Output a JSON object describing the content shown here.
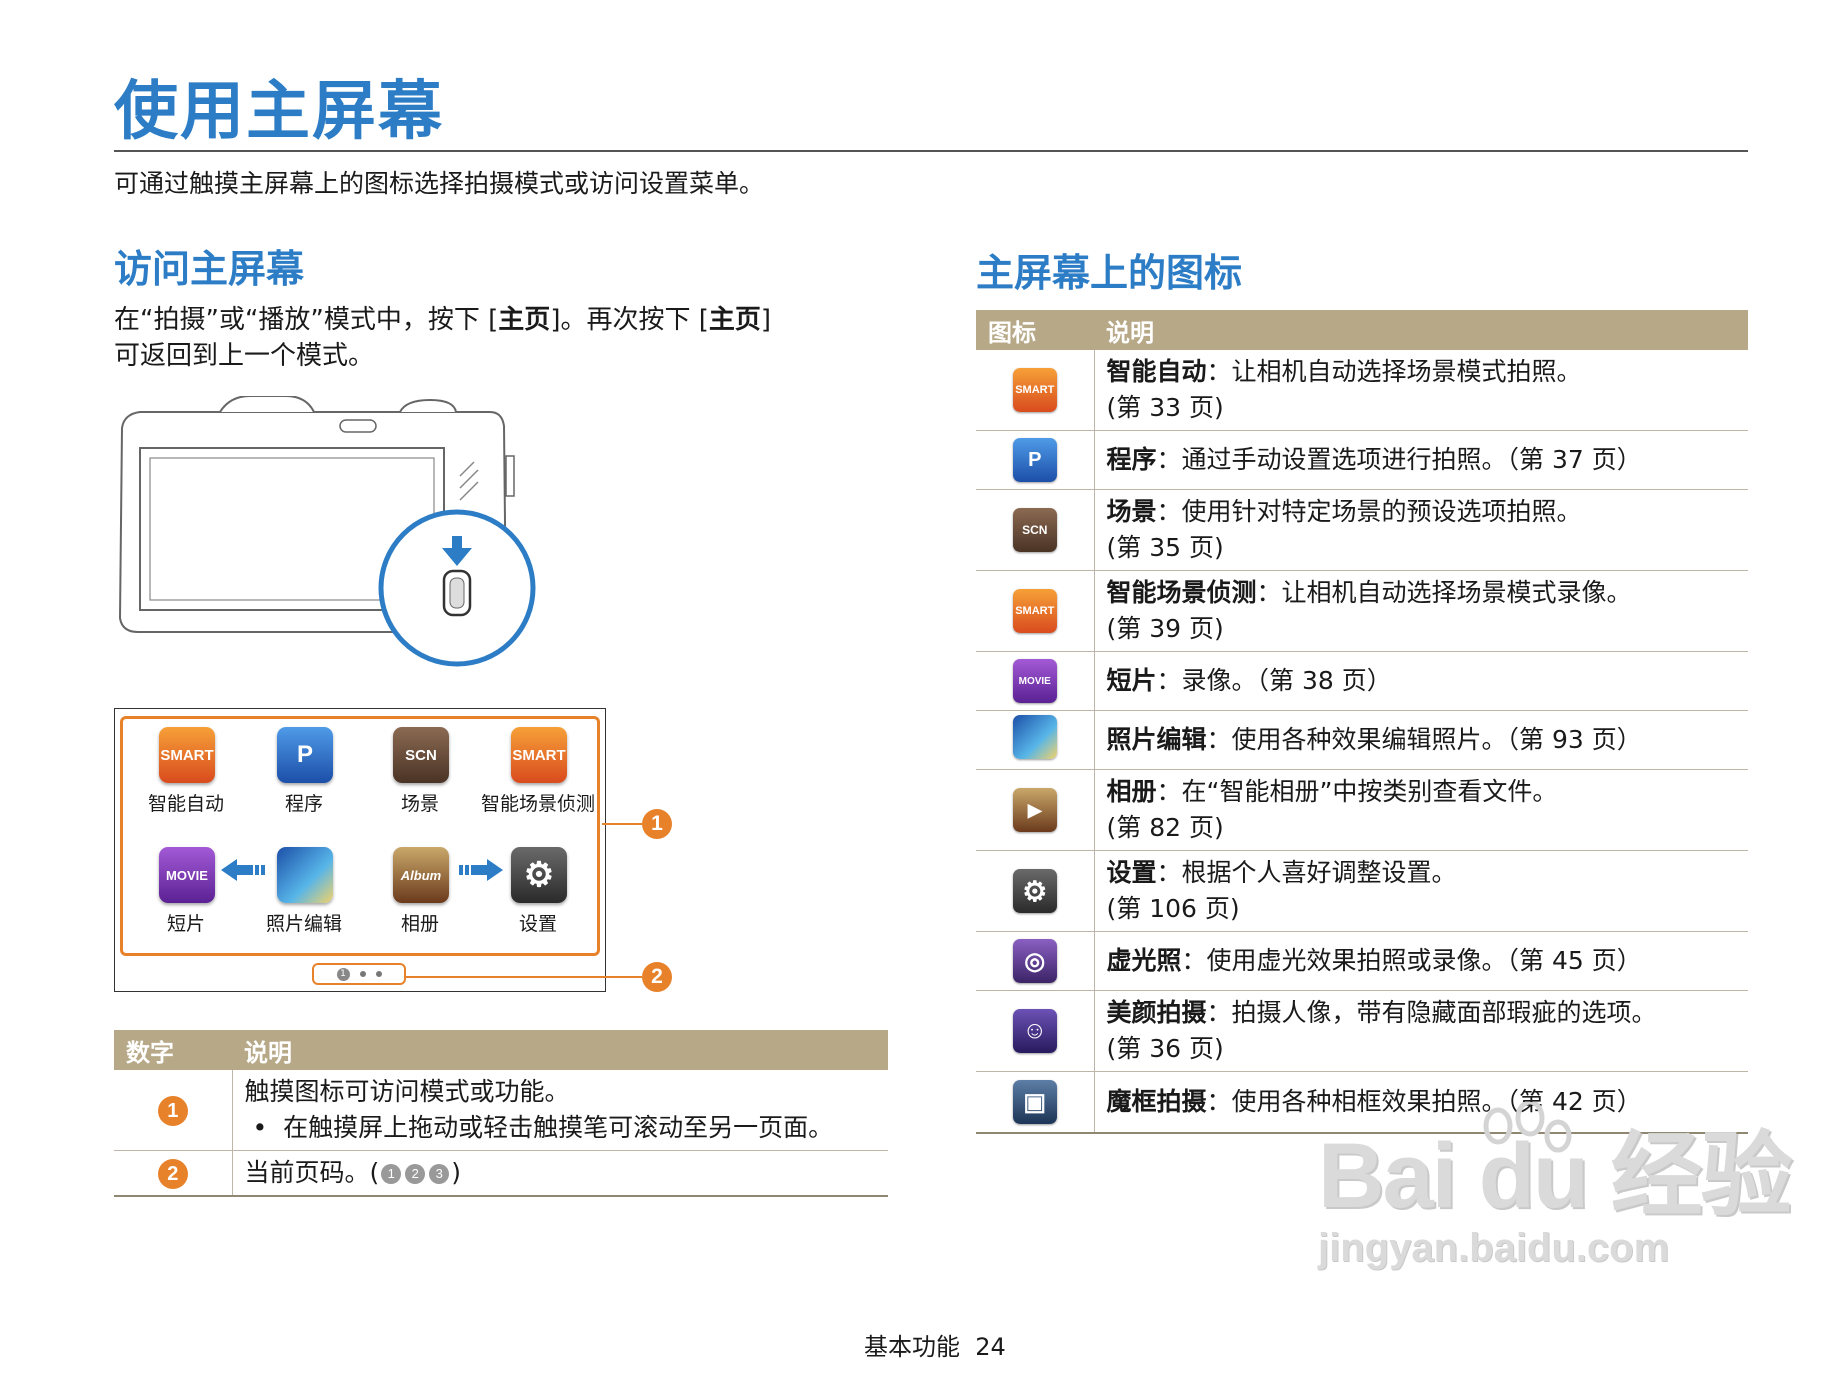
{
  "page": {
    "title": "使用主屏幕",
    "subtitle": "可通过触摸主屏幕上的图标选择拍摄模式或访问设置菜单。",
    "footer": "基本功能  24"
  },
  "left": {
    "heading": "访问主屏幕",
    "para_1a": "在“拍摄”或“播放”模式中，按下 [",
    "para_1b": "主页",
    "para_1c": "]。再次按下 [",
    "para_1d": "主页",
    "para_1e": "]",
    "para_2": "可返回到上一个模式。",
    "home_icons": [
      {
        "label": "智能自动",
        "glyph": "SMART"
      },
      {
        "label": "程序",
        "glyph": "P"
      },
      {
        "label": "场景",
        "glyph": "SCN"
      },
      {
        "label": "智能场景侦测",
        "glyph": "SMART"
      },
      {
        "label": "短片",
        "glyph": "MOVIE"
      },
      {
        "label": "照片编辑",
        "glyph": ""
      },
      {
        "label": "相册",
        "glyph": "Album"
      },
      {
        "label": "设置",
        "glyph": "⚙"
      }
    ],
    "callouts": [
      "1",
      "2"
    ],
    "pager_current": "1",
    "table": {
      "headers": [
        "数字",
        "说明"
      ],
      "rows": [
        {
          "num": "1",
          "line1": "触摸图标可访问模式或功能。",
          "bullet": "在触摸屏上拖动或轻击触摸笔可滚动至另一页面。"
        },
        {
          "num": "2",
          "line1": "当前页码。(",
          "pages": [
            "1",
            "2",
            "3"
          ],
          "line1_end": ")"
        }
      ]
    }
  },
  "right": {
    "heading": "主屏幕上的图标",
    "table": {
      "headers": [
        "图标",
        "说明"
      ],
      "rows": [
        {
          "icon": "smart-auto-icon",
          "glyph": "SMART",
          "name": "智能自动",
          "desc": "：让相机自动选择场景模式拍照。",
          "page": "(第 33 页)"
        },
        {
          "icon": "program-icon",
          "glyph": "P",
          "name": "程序",
          "desc": "：通过手动设置选项进行拍照。（第 37 页）",
          "page": ""
        },
        {
          "icon": "scene-icon",
          "glyph": "SCN",
          "name": "场景",
          "desc": "：使用针对特定场景的预设选项拍照。",
          "page": "(第 35 页)"
        },
        {
          "icon": "smart-scene-detect-icon",
          "glyph": "SMART",
          "name": "智能场景侦测",
          "desc": "：让相机自动选择场景模式录像。",
          "page": "(第 39 页)"
        },
        {
          "icon": "movie-icon",
          "glyph": "MOVIE",
          "name": "短片",
          "desc": "：录像。（第 38 页）",
          "page": ""
        },
        {
          "icon": "photo-editor-icon",
          "glyph": "",
          "name": "照片编辑",
          "desc": "：使用各种效果编辑照片。（第 93 页）",
          "page": ""
        },
        {
          "icon": "album-icon",
          "glyph": "▶",
          "name": "相册",
          "desc": "：在“智能相册”中按类别查看文件。",
          "page": "(第 82 页)"
        },
        {
          "icon": "settings-icon",
          "glyph": "⚙",
          "name": "设置",
          "desc": "：根据个人喜好调整设置。",
          "page": "(第 106 页)"
        },
        {
          "icon": "dual-is-icon",
          "glyph": "◎",
          "name": "虚光照",
          "desc": "：使用虚光效果拍照或录像。（第 45 页）",
          "page": ""
        },
        {
          "icon": "beauty-shot-icon",
          "glyph": "☺",
          "name": "美颜拍摄",
          "desc": "：拍摄人像，带有隐藏面部瑕疵的选项。",
          "page": "(第 36 页)"
        },
        {
          "icon": "magic-frame-icon",
          "glyph": "▣",
          "name": "魔框拍摄",
          "desc": "：使用各种相框效果拍照。（第 42 页）",
          "page": ""
        }
      ]
    }
  },
  "watermark": {
    "big": "Bai du 经验",
    "small": "jingyan.baidu.com"
  },
  "colors": {
    "title_blue": "#2c7dc6",
    "accent_orange": "#e8822a",
    "table_header": "#b7a988"
  }
}
